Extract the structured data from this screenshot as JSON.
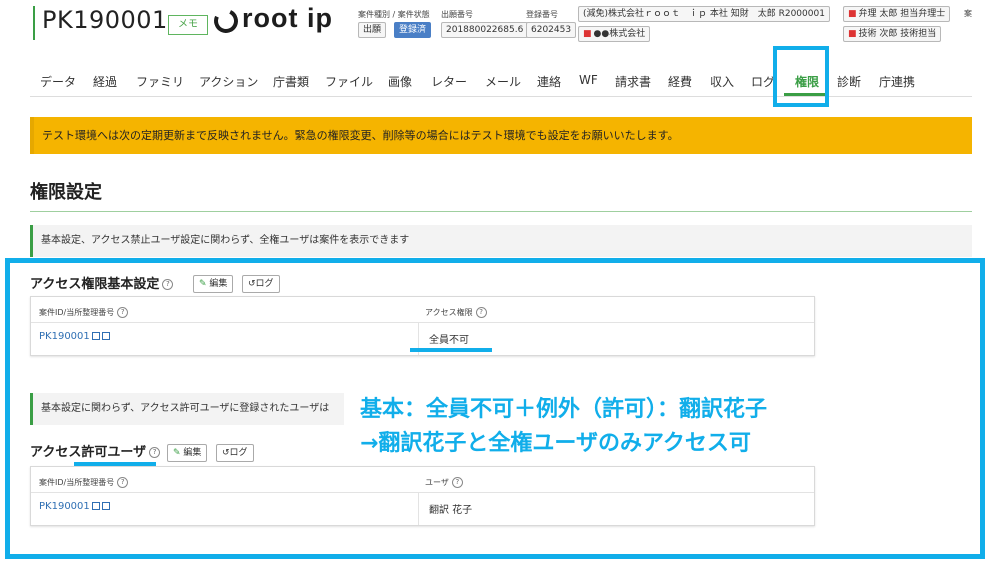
{
  "header": {
    "case_id": "PK190001",
    "memo_label": "メモ",
    "logo_text": "root ip",
    "case_type_label": "案件種別 / 案件状態",
    "case_type": "出願",
    "case_status": "登録済",
    "app_no_label": "出願番号",
    "app_no": "201880022685.6",
    "reg_no_label": "登録番号",
    "reg_no": "6202453",
    "client1": "(減免)株式会社ｒｏｏｔ　ｉｐ 本社 知財　太郎 R2000001",
    "client2": "●●株式会社",
    "attorney1": "弁理 太郎 担当弁理士",
    "attorney2": "技術 次郎 技術担当",
    "edge_char": "案"
  },
  "tabs": [
    {
      "label": "データ",
      "active": false
    },
    {
      "label": "経過",
      "active": false
    },
    {
      "label": "ファミリ",
      "active": false
    },
    {
      "label": "アクション",
      "active": false
    },
    {
      "label": "庁書類",
      "active": false
    },
    {
      "label": "ファイル",
      "active": false
    },
    {
      "label": "画像",
      "active": false
    },
    {
      "label": "レター",
      "active": false
    },
    {
      "label": "メール",
      "active": false
    },
    {
      "label": "連絡",
      "active": false
    },
    {
      "label": "WF",
      "active": false
    },
    {
      "label": "請求書",
      "active": false
    },
    {
      "label": "経費",
      "active": false
    },
    {
      "label": "収入",
      "active": false
    },
    {
      "label": "ログ",
      "active": false
    },
    {
      "label": "権限",
      "active": true
    },
    {
      "label": "診断",
      "active": false
    },
    {
      "label": "庁連携",
      "active": false
    }
  ],
  "warning_text": "テスト環境へは次の定期更新まで反映されません。緊急の権限変更、削除等の場合にはテスト環境でも設定をお願いいたします。",
  "page_title": "権限設定",
  "info1": "基本設定、アクセス禁止ユーザ設定に関わらず、全権ユーザは案件を表示できます",
  "basic": {
    "title": "アクセス権限基本設定",
    "edit_label": "編集",
    "log_label": "ログ",
    "col1": "案件ID/当所整理番号",
    "col2": "アクセス権限",
    "row_id": "PK190001",
    "row_value": "全員不可"
  },
  "info2": "基本設定に関わらず、アクセス許可ユーザに登録されたユーザは",
  "permit": {
    "title": "アクセス許可ユーザ",
    "edit_label": "編集",
    "log_label": "ログ",
    "col1": "案件ID/当所整理番号",
    "col2": "ユーザ",
    "row_id": "PK190001",
    "row_value": "翻訳 花子"
  },
  "annotation": {
    "line1": "基本：全員不可＋例外（許可）：翻訳花子",
    "line2": "→翻訳花子と全権ユーザのみアクセス可"
  },
  "colors": {
    "accent_green": "#3a9e45",
    "highlight_blue": "#11aeea",
    "warning_yellow": "#f5b400",
    "link_blue": "#2f6fb3"
  }
}
